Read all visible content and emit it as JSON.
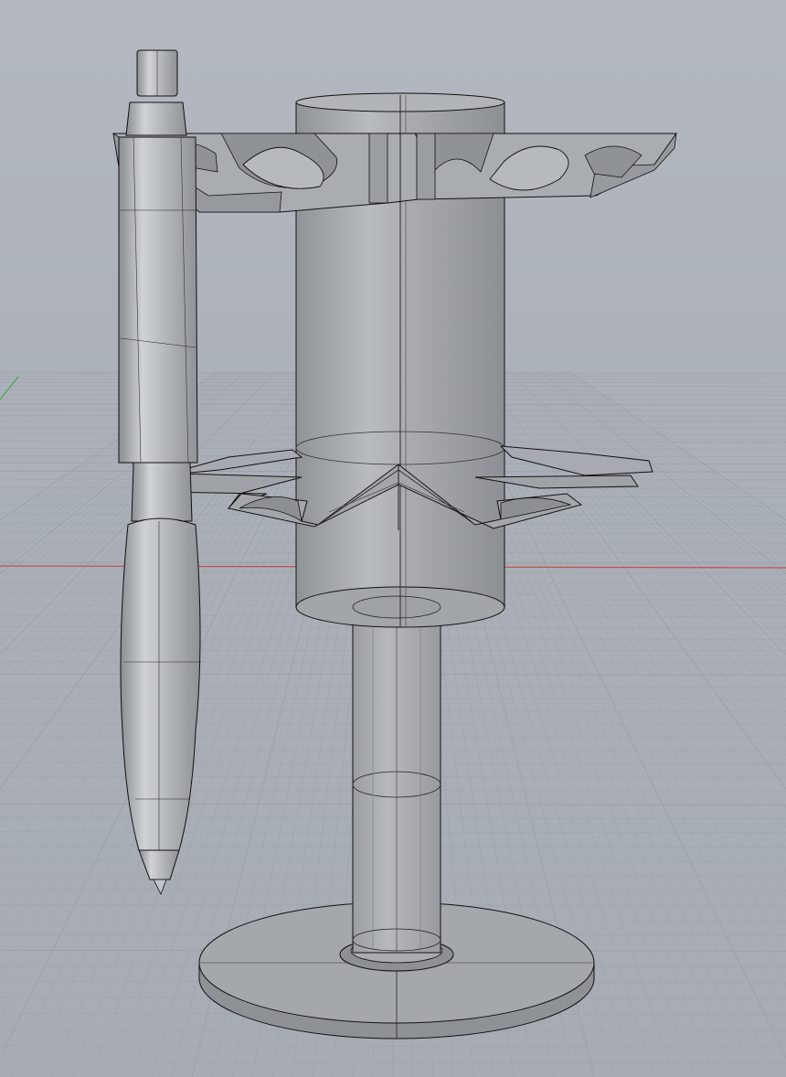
{
  "viewport": {
    "projection": "perspective",
    "display_mode": "shaded-transparent",
    "background_color": "#b0b5bd",
    "grid_color": "#9ca1a9",
    "x_axis_color": "#c0504d",
    "y_axis_color": "#41a94b",
    "model_fill_color": "#a0a3a8",
    "model_edge_color": "#111111"
  },
  "model": {
    "objects": [
      {
        "name": "pen",
        "icon": "pen-icon"
      },
      {
        "name": "upper-pen-holder-ring",
        "icon": "ring-icon"
      },
      {
        "name": "upper-cylinder",
        "icon": "cylinder-icon"
      },
      {
        "name": "star-flange",
        "icon": "star-icon"
      },
      {
        "name": "stem",
        "icon": "cylinder-icon"
      },
      {
        "name": "base-disk",
        "icon": "disk-icon"
      }
    ]
  }
}
